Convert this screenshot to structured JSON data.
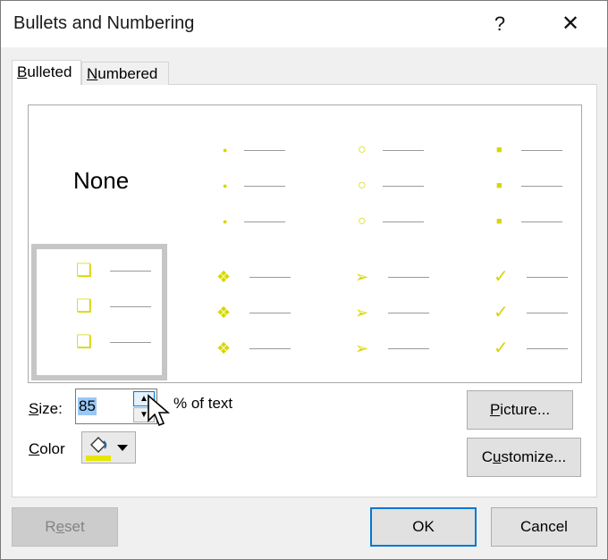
{
  "dialog": {
    "title": "Bullets and Numbering",
    "help_label": "?",
    "close_label": "✕"
  },
  "tabs": [
    {
      "label_first": "B",
      "label_rest": "ulleted",
      "active": true
    },
    {
      "label_first": "N",
      "label_rest": "umbered",
      "active": false
    }
  ],
  "gallery": {
    "none_label": "None",
    "bullet_color": "#d7d700",
    "selection_color": "#c6c6c6",
    "styles": [
      {
        "icon": "small-dot-icon",
        "glyph": "●",
        "selected": false
      },
      {
        "icon": "hollow-circle-icon",
        "glyph": "○",
        "selected": false
      },
      {
        "icon": "square-icon",
        "glyph": "■",
        "selected": false
      },
      {
        "icon": "shadowed-square-icon",
        "glyph": "❑",
        "selected": true
      },
      {
        "icon": "four-diamond-icon",
        "glyph": "❖",
        "selected": false
      },
      {
        "icon": "arrowhead-icon",
        "glyph": "➢",
        "selected": false
      },
      {
        "icon": "checkmark-icon",
        "glyph": "✓",
        "selected": false
      }
    ]
  },
  "size": {
    "label_first": "S",
    "label_rest": "ize:",
    "value": "85",
    "suffix": "% of text"
  },
  "color": {
    "label_first": "C",
    "label_rest": "olor",
    "swatch": "#e6e600"
  },
  "buttons": {
    "picture_first": "P",
    "picture_rest": "icture...",
    "customize_pre": "C",
    "customize_u": "u",
    "customize_rest": "stomize...",
    "reset_pre": "R",
    "reset_u": "e",
    "reset_rest": "set",
    "ok": "OK",
    "cancel": "Cancel"
  }
}
